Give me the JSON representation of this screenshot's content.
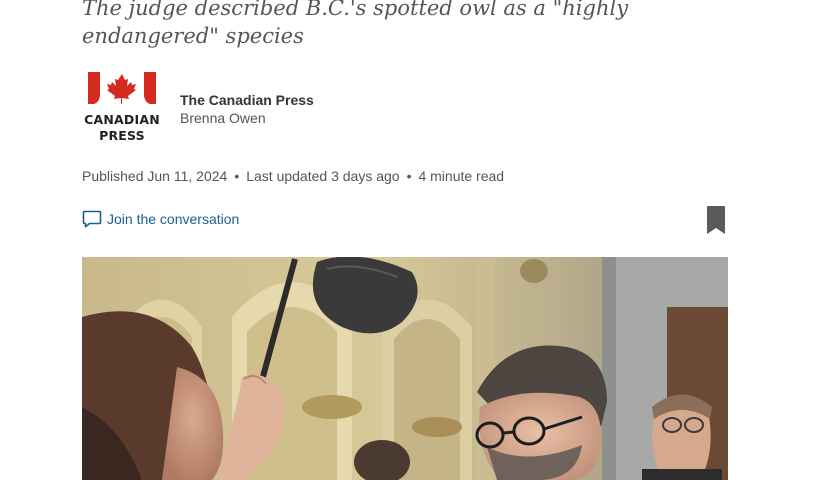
{
  "article": {
    "subheadline": "The judge described B.C.'s spotted owl as a \"highly endangered\" species",
    "publisher_logo": {
      "line1": "CANADIAN",
      "line2": "PRESS",
      "color": "#d52b1e"
    },
    "publisher": "The Canadian Press",
    "author": "Brenna Owen",
    "published": "Published Jun 11, 2024",
    "last_updated": "Last updated 3 days ago",
    "read_time": "4 minute read",
    "separator": "•",
    "conversation_label": "Join the conversation",
    "icons": {
      "conversation": "speech-bubble-icon",
      "bookmark": "bookmark-icon"
    },
    "colors": {
      "link": "#1a5e8e",
      "bookmark": "#5a5a5a"
    }
  }
}
